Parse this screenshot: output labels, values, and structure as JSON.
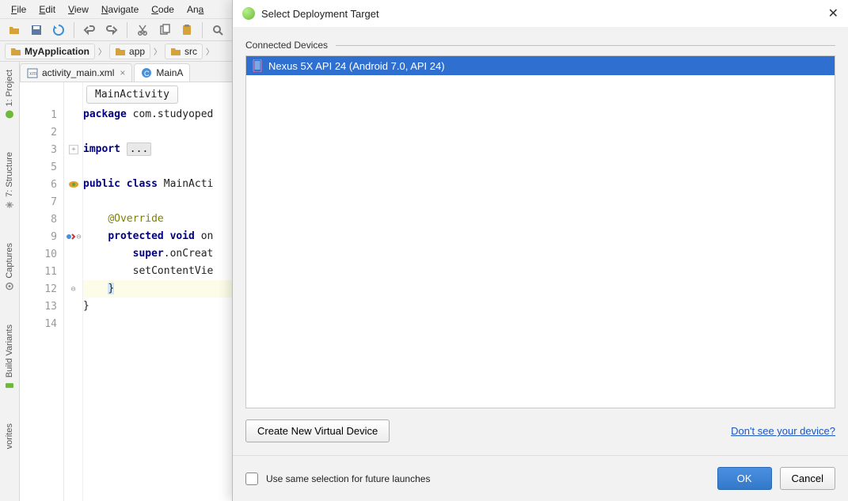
{
  "menubar": {
    "items": [
      "File",
      "Edit",
      "View",
      "Navigate",
      "Code",
      "Ana"
    ]
  },
  "breadcrumb": {
    "items": [
      {
        "label": "MyApplication",
        "bold": true
      },
      {
        "label": "app"
      },
      {
        "label": "src"
      }
    ]
  },
  "file_tabs": [
    {
      "label": "activity_main.xml",
      "icon": "xml",
      "closable": true,
      "active": false
    },
    {
      "label": "MainA",
      "icon": "class",
      "closable": false,
      "active": true
    }
  ],
  "code_breadcrumb": "MainActivity",
  "left_tabs": [
    "1: Project",
    "7: Structure",
    "Captures",
    "Build Variants",
    "vorites"
  ],
  "code": {
    "lines": [
      {
        "n": 1,
        "html": "<span class='tk-kw'>package</span> com.studyoped"
      },
      {
        "n": 2,
        "html": ""
      },
      {
        "n": 3,
        "html": "<span class='tk-kw'>import</span> <span class='tk-fold'>...</span>",
        "fold": "+"
      },
      {
        "n": 5,
        "html": ""
      },
      {
        "n": 6,
        "html": "<span class='tk-kw'>public class</span> MainActi",
        "marker": "eye"
      },
      {
        "n": 7,
        "html": ""
      },
      {
        "n": 8,
        "html": "    <span class='tk-anno'>@Override</span>"
      },
      {
        "n": 9,
        "html": "    <span class='tk-kw'>protected void</span> on",
        "marker": "impl",
        "fold": "-"
      },
      {
        "n": 10,
        "html": "        <span class='tk-kw'>super</span>.onCreat"
      },
      {
        "n": 11,
        "html": "        setContentVie"
      },
      {
        "n": 12,
        "html": "    <span class='cursor-brace'>}</span>",
        "hl": true,
        "fold": "-"
      },
      {
        "n": 13,
        "html": "}"
      },
      {
        "n": 14,
        "html": ""
      }
    ]
  },
  "dialog": {
    "title": "Select Deployment Target",
    "section": "Connected Devices",
    "devices": [
      {
        "label": "Nexus 5X API 24 (Android 7.0, API 24)",
        "selected": true
      }
    ],
    "create_btn": "Create New Virtual Device",
    "help_link": "Don't see your device?",
    "checkbox_label": "Use same selection for future launches",
    "ok": "OK",
    "cancel": "Cancel"
  }
}
